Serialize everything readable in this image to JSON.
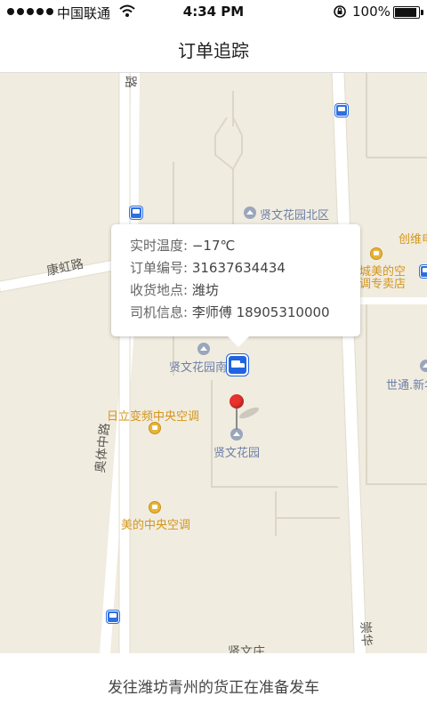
{
  "status_bar": {
    "carrier": "中国联通",
    "time": "4:34 PM",
    "battery": "100%",
    "battery_level": 1.0
  },
  "nav": {
    "title": "订单追踪"
  },
  "map": {
    "pois": {
      "xianwen_north": "贤文花园北区",
      "xianwen_south": "贤文花园南",
      "xianwen": "贤文花园",
      "hitachi": "日立变频中央空调",
      "midea": "美的中央空调",
      "chuangwei": "创维电",
      "chengmei_1": "城美的空",
      "chengmei_2": "调专卖店",
      "shitong": "世通.新华"
    },
    "roads": {
      "kanghong": "康虹路",
      "aoti_zhong": "奥体中路",
      "chonghua": "崇华",
      "top_road": "路",
      "xianwen_road": "贤文庄"
    }
  },
  "popup": {
    "temp_label": "实时温度:",
    "temp_value": "−17℃",
    "order_label": "订单编号:",
    "order_value": "31637634434",
    "dest_label": "收货地点:",
    "dest_value": "潍坊",
    "driver_label": "司机信息:",
    "driver_value": "李师傅  18905310000"
  },
  "footer": {
    "status_text": "发往潍坊青州的货正在准备发车"
  },
  "colors": {
    "map_bg": "#f1ece0",
    "road": "#ffffff",
    "accent_blue": "#1f64e0",
    "pin_red": "#e8322e",
    "poi_orange": "#d3961a"
  }
}
